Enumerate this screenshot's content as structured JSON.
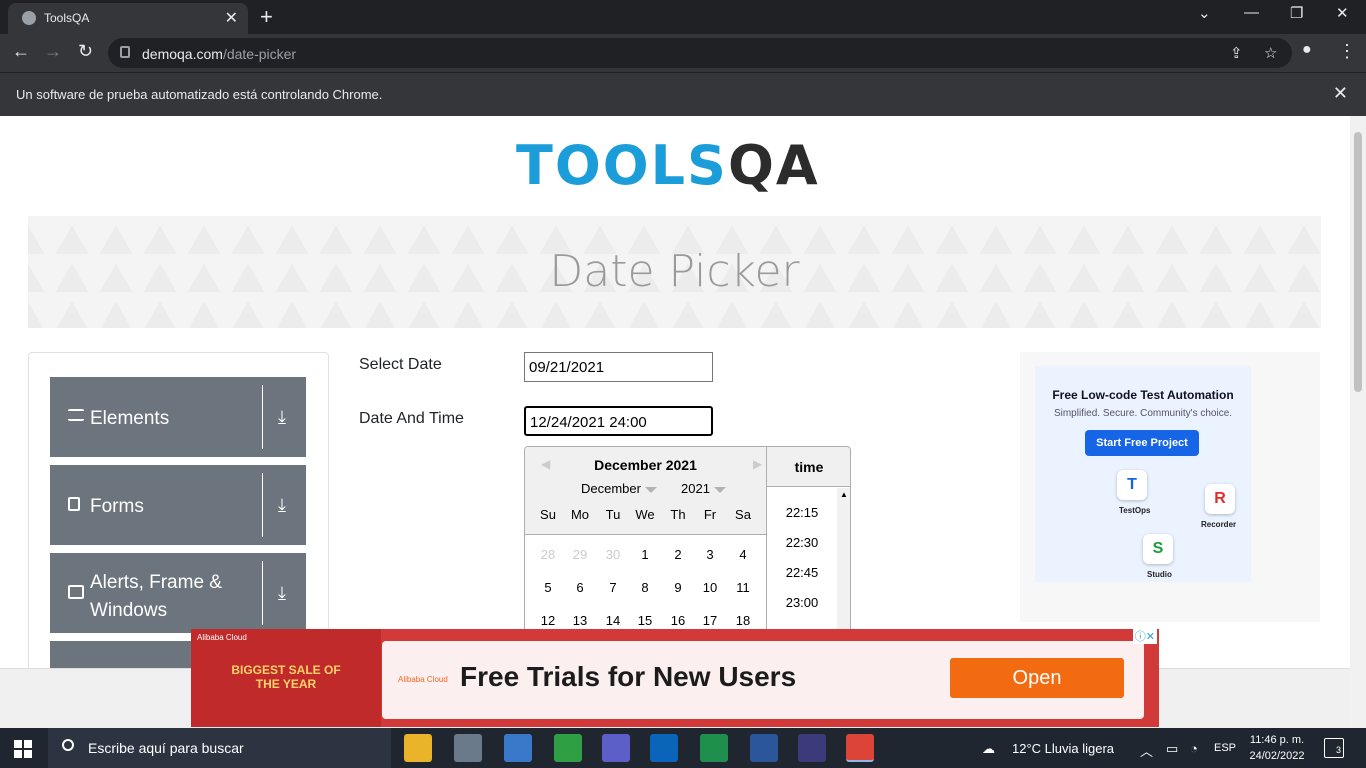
{
  "browser": {
    "tab_title": "ToolsQA",
    "url_domain": "demoqa.com",
    "url_path": "/date-picker",
    "infobar_message": "Un software de prueba automatizado está controlando Chrome."
  },
  "page": {
    "logo_tools": "TOOLS",
    "logo_qa": "QA",
    "title": "Date Picker",
    "sidebar": [
      {
        "label": "Elements"
      },
      {
        "label": "Forms"
      },
      {
        "label": "Alerts, Frame & Windows"
      }
    ],
    "select_date_label": "Select Date",
    "select_date_value": "09/21/2021",
    "datetime_label": "Date And Time",
    "datetime_value": "12/24/2021 24:00"
  },
  "datepicker": {
    "month_title": "December 2021",
    "month_select": "December",
    "year_select": "2021",
    "weekdays": [
      "Su",
      "Mo",
      "Tu",
      "We",
      "Th",
      "Fr",
      "Sa"
    ],
    "weeks": [
      [
        "28",
        "29",
        "30",
        "1",
        "2",
        "3",
        "4"
      ],
      [
        "5",
        "6",
        "7",
        "8",
        "9",
        "10",
        "11"
      ],
      [
        "12",
        "13",
        "14",
        "15",
        "16",
        "17",
        "18"
      ]
    ],
    "time_header": "time",
    "times": [
      "22:15",
      "22:30",
      "22:45",
      "23:00"
    ]
  },
  "ad_right": {
    "title": "Free Low-code Test Automation",
    "subtitle": "Simplified. Secure. Community's choice.",
    "button": "Start Free Project",
    "labels": [
      "TestOps",
      "Recorder",
      "Studio"
    ]
  },
  "ad_bottom": {
    "brand": "Alibaba Cloud",
    "sale": "BIGGEST SALE OF THE YEAR",
    "headline": "Free Trials for New Users",
    "button": "Open"
  },
  "taskbar": {
    "search_placeholder": "Escribe aquí para buscar",
    "weather": "12°C  Lluvia ligera",
    "lang": "ESP",
    "time": "11:46 p. m.",
    "date": "24/02/2022",
    "notifications": "3"
  },
  "colors": {
    "accent": "#1b9dd9",
    "sidebar_group": "#6c757d",
    "ad_orange": "#f26b10"
  }
}
